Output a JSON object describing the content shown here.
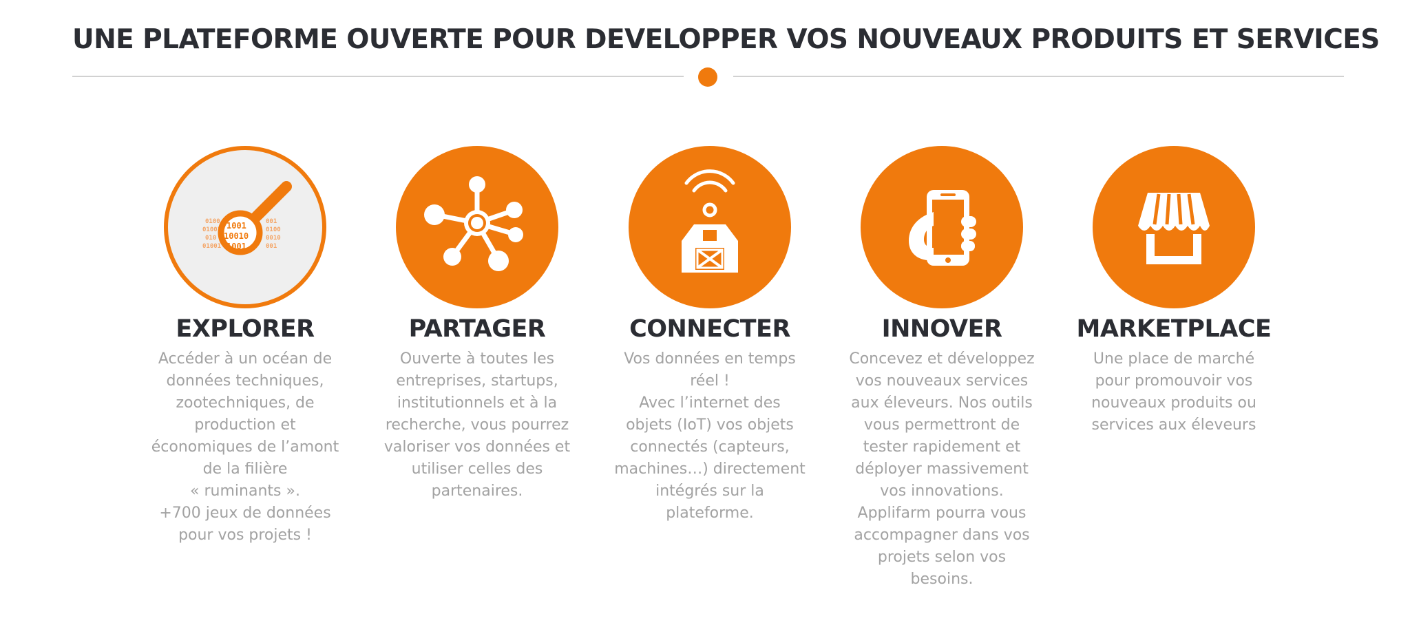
{
  "page": {
    "title": "UNE PLATEFORME OUVERTE POUR DEVELOPPER VOS NOUVEAUX PRODUITS ET SERVICES"
  },
  "colors": {
    "accent": "#f07a0d",
    "title_text": "#2b2d33",
    "body_text": "#a2a2a2",
    "divider": "#d1d1d1",
    "icon_light_bg": "#efefef"
  },
  "features": [
    {
      "icon": "magnifier-binary-icon",
      "title": "EXPLORER",
      "lines": [
        "Accéder à un océan de",
        "données techniques,",
        "zootechniques, de",
        "production et",
        "économiques de l’amont",
        "de la filière",
        "« ruminants ».",
        "+700 jeux de données",
        "pour vos projets !"
      ]
    },
    {
      "icon": "network-hub-icon",
      "title": "PARTAGER",
      "lines": [
        "Ouverte à toutes les",
        "entreprises, startups,",
        "institutionnels et à la",
        "recherche, vous pourrez",
        "valoriser vos données et",
        "utiliser celles des",
        "partenaires."
      ]
    },
    {
      "icon": "connected-barn-icon",
      "title": "CONNECTER",
      "lines": [
        "Vos données en temps",
        "réel !",
        "Avec l’internet des",
        "objets (IoT) vos objets",
        "connectés (capteurs,",
        "machines…) directement",
        "intégrés sur la",
        "plateforme."
      ]
    },
    {
      "icon": "hand-smartphone-icon",
      "title": "INNOVER",
      "lines": [
        "Concevez et développez",
        "vos nouveaux services",
        "aux éleveurs. Nos outils",
        "vous permettront de",
        "tester rapidement et",
        "déployer massivement",
        "vos innovations.",
        "Applifarm pourra vous",
        "accompagner dans vos",
        "projets selon vos",
        "besoins."
      ]
    },
    {
      "icon": "market-stall-icon",
      "title": "MARKETPLACE",
      "lines": [
        "Une place de marché",
        "pour promouvoir vos",
        "nouveaux produits ou",
        "services aux éleveurs"
      ]
    }
  ]
}
